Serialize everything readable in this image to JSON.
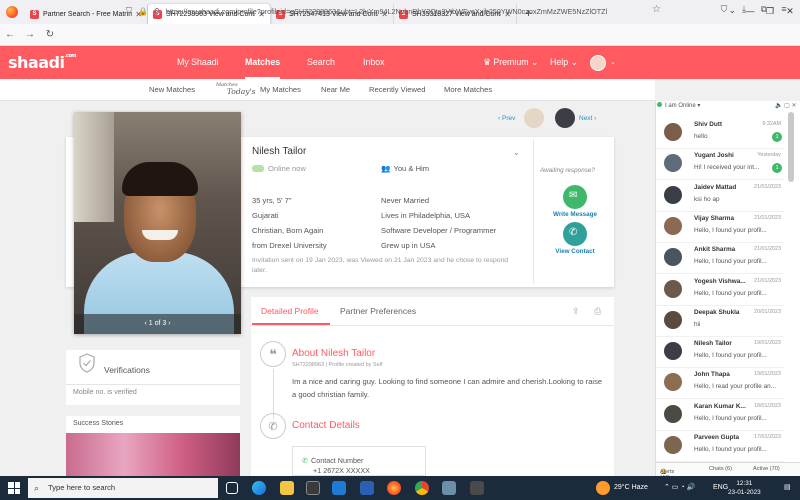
{
  "browser": {
    "tabs": [
      {
        "title": "Partner Search - Free Matrimoni",
        "active": false
      },
      {
        "title": "SH72298963 View and Contact N",
        "active": true
      },
      {
        "title": "SH72547413 View and Contact N",
        "active": false
      },
      {
        "title": "SH35318327 View and Contact N",
        "active": false
      }
    ],
    "new_tab": "+",
    "url": "https://my.shaadi.com/profile?profileid=gSH72298963&ubt=L2luYm94L2NvbnRhY3Qtc3VtbWFyeXxjb250YWN0czoxZmMzZWE5NzZlOTZl"
  },
  "header": {
    "logo": "shaadi",
    "logo_sup": ".com",
    "nav": [
      {
        "label": "My Shaadi",
        "active": false
      },
      {
        "label": "Matches",
        "active": true
      },
      {
        "label": "Search",
        "active": false
      },
      {
        "label": "Inbox",
        "active": false
      }
    ],
    "premium": "Premium",
    "help": "Help"
  },
  "subnav": {
    "items": [
      "New Matches",
      "My Matches",
      "Near Me",
      "Recently Viewed",
      "More Matches"
    ],
    "today_line1": "Today's",
    "today_line2": "Matches"
  },
  "pager_nav": {
    "prev": "Prev",
    "next": "Next"
  },
  "profile": {
    "name": "Nilesh Tailor",
    "online": "Online now",
    "relation": "You & Him",
    "left_attrs": [
      "35 yrs, 5' 7\"",
      "Gujarati",
      "Christian, Born Again",
      "from Drexel University"
    ],
    "right_attrs": [
      "Never Married",
      "Lives in Philadelphia, USA",
      "Software Developer / Programmer",
      "Grew up in USA"
    ],
    "invitation": "Invitation sent on 19 Jan 2023, was Viewed on 21 Jan 2023 and he chose to respond later.",
    "photo_counter": "1 of 3",
    "awaiting": "Awaiting response?",
    "write_message": "Write Message",
    "view_contact": "View Contact"
  },
  "verifications": {
    "title": "Verifications",
    "mobile": "Mobile no. is verified"
  },
  "success_stories": {
    "title": "Success Stories"
  },
  "detail": {
    "tab_detailed": "Detailed Profile",
    "tab_partner": "Partner Preferences",
    "about_title": "About Nilesh Tailor",
    "about_meta": "SH72298963  |  Profile created by Self",
    "about_text": "Im a nice and caring guy. Looking to find someone I can admire and cherish.Looking to raise a good christian family.",
    "contact_title": "Contact Details",
    "contact_label": "Contact Number",
    "contact_value": "+1 2672X XXXXX"
  },
  "chat": {
    "status": "I am Online",
    "items": [
      {
        "name": "Shiv Dutt",
        "time": "9:32AM",
        "msg": "hello",
        "badge": "1"
      },
      {
        "name": "Yugant Joshi",
        "time": "Yesterday",
        "msg": "Hi! I received your int...",
        "badge": "1"
      },
      {
        "name": "Jaidev Mattad",
        "time": "21/01/2023",
        "msg": "ksi ho ap",
        "badge": ""
      },
      {
        "name": "Vijay Sharma",
        "time": "21/01/2023",
        "msg": "Hello, I found your profil...",
        "badge": ""
      },
      {
        "name": "Ankit Sharma",
        "time": "21/01/2023",
        "msg": "Hello, I found your profil...",
        "badge": ""
      },
      {
        "name": "Yogesh Vishwa...",
        "time": "21/01/2023",
        "msg": "Hello, I found your profil...",
        "badge": ""
      },
      {
        "name": "Deepak Shukla",
        "time": "20/01/2023",
        "msg": "hii",
        "badge": ""
      },
      {
        "name": "Nilesh Tailor",
        "time": "19/01/2023",
        "msg": "Hello, I found your profil...",
        "badge": ""
      },
      {
        "name": "John Thapa",
        "time": "19/01/2023",
        "msg": "Hello, I read your profile an...",
        "badge": ""
      },
      {
        "name": "Karan Kumar K...",
        "time": "18/01/2023",
        "msg": "Hello, I found your profil...",
        "badge": ""
      },
      {
        "name": "Parveen Gupta",
        "time": "17/01/2023",
        "msg": "Hello, I found your profil...",
        "badge": ""
      }
    ],
    "footer_alerts": "Alerts (44)",
    "footer_chats": "Chats (6)",
    "footer_active": "Active (70)"
  },
  "taskbar": {
    "search_placeholder": "Type here to search",
    "weather": "29°C  Haze",
    "lang": "ENG",
    "time": "12:31",
    "date": "23-01-2023"
  },
  "colors": {
    "brand": "#ff5a60",
    "online_green": "#40b86b",
    "link_blue": "#1d7fb2"
  }
}
